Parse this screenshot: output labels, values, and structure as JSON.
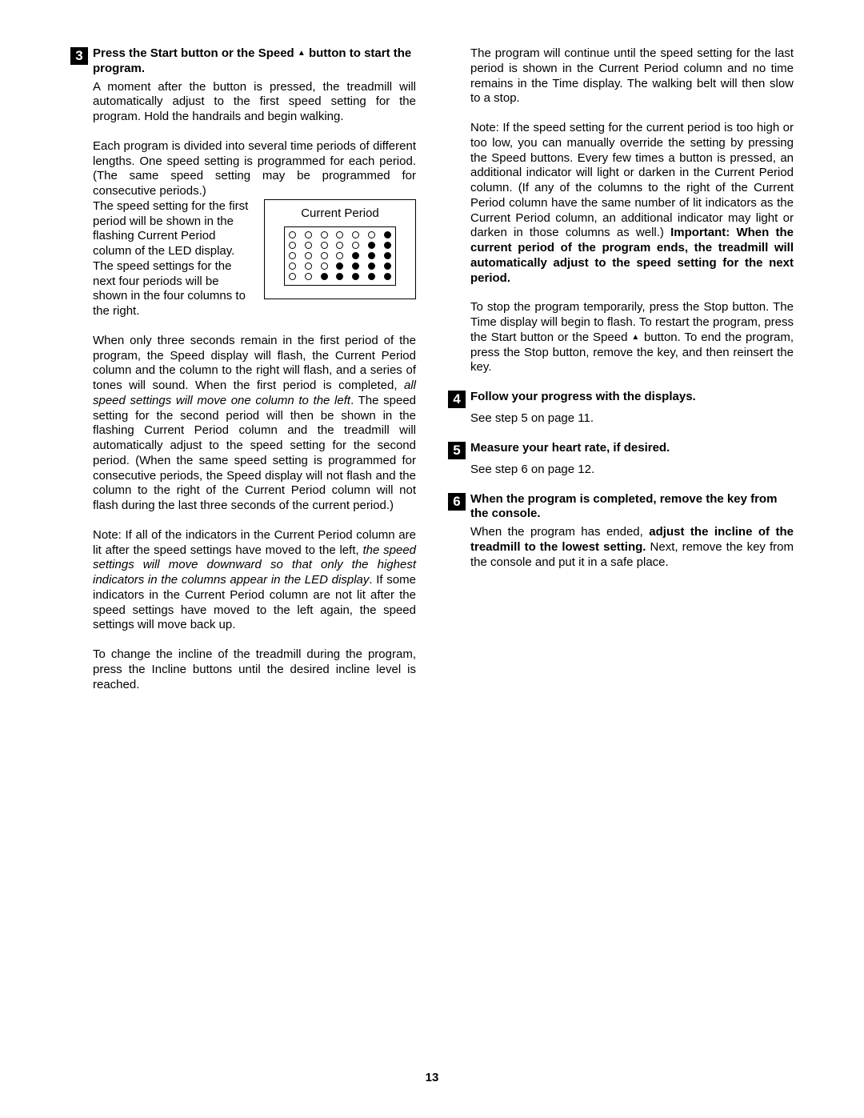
{
  "page_number": "13",
  "left": {
    "step3": {
      "num": "3",
      "title_a": "Press the Start button or the Speed ",
      "title_b": " button to start the program.",
      "p1": "A moment after the button is pressed, the treadmill will automatically adjust to the first speed setting for the program. Hold the handrails and begin walking.",
      "p2": "Each program is divided into several time periods of different lengths. One speed setting is programmed for each period. (The same speed setting may be programmed for consecutive periods.)",
      "p3": "The speed setting for the first period will be shown in the flashing Current Period column of the LED display. The speed settings for the next four periods will be shown in the four columns to the right.",
      "fig_label": "Current Period",
      "p4a": "When only three seconds remain in the first period of the program, the Speed display will flash, the Current Period column and the column to the right will flash, and a series of tones will sound. When the first period is completed, ",
      "p4i": "all speed settings will move one column to the left",
      "p4b": ". The speed setting for the second period will then be shown in the flashing Current Period column and the treadmill will automatically adjust to the speed setting for the second period. (When the same speed setting is programmed for consecutive periods, the Speed display will not flash and the column to the right of the Current Period column will not flash during the last three seconds of the current period.)",
      "p5a": "Note: If all of the indicators in the Current Period column are lit after the speed settings have moved to the left, ",
      "p5i": "the speed settings will move downward so that only the highest indicators in the columns appear in the LED display",
      "p5b": ". If some indicators in the Current Period column are not lit after the speed settings have moved to the left again, the speed settings will move back up.",
      "p6": "To change the incline of the treadmill during the program, press the Incline buttons until the desired incline level is reached."
    }
  },
  "right": {
    "cont": {
      "p1": "The program will continue until the speed setting for the last period is shown in the Current Period column and no time remains in the Time display. The walking belt will then slow to a stop.",
      "p2a": "Note: If the speed setting for the current period is too high or too low, you can manually override the setting by pressing the Speed buttons. Every few times a button is pressed, an additional indicator will light or darken in the Current Period column. (If any of the columns to the right of the Current Period column have the same number of lit indicators as the Current Period column, an additional indicator may light or darken in those columns as well.) ",
      "p2b": "Important: When the current period of the program ends, the treadmill will automatically adjust to the speed setting for the next period.",
      "p3a": "To stop the program temporarily, press the Stop button. The Time display will begin to flash. To restart the program, press the Start button or the Speed ",
      "p3b": " button. To end the program, press the Stop button, remove the key, and then reinsert the key."
    },
    "step4": {
      "num": "4",
      "title": "Follow your progress with the displays.",
      "body": "See step 5 on page 11."
    },
    "step5": {
      "num": "5",
      "title": "Measure your heart rate, if desired.",
      "body": "See step 6 on page 12."
    },
    "step6": {
      "num": "6",
      "title": "When the program is completed, remove the key from the console.",
      "body_a": "When the program has ended, ",
      "body_bold": "adjust the incline of the treadmill to the lowest setting.",
      "body_b": " Next, remove the key from the console and put it in a safe place."
    }
  },
  "led": [
    [
      0,
      0,
      0,
      0,
      0,
      0,
      1
    ],
    [
      0,
      0,
      0,
      0,
      0,
      1,
      1
    ],
    [
      0,
      0,
      0,
      0,
      1,
      1,
      1
    ],
    [
      0,
      0,
      0,
      1,
      1,
      1,
      1
    ],
    [
      0,
      0,
      1,
      1,
      1,
      1,
      1
    ]
  ]
}
